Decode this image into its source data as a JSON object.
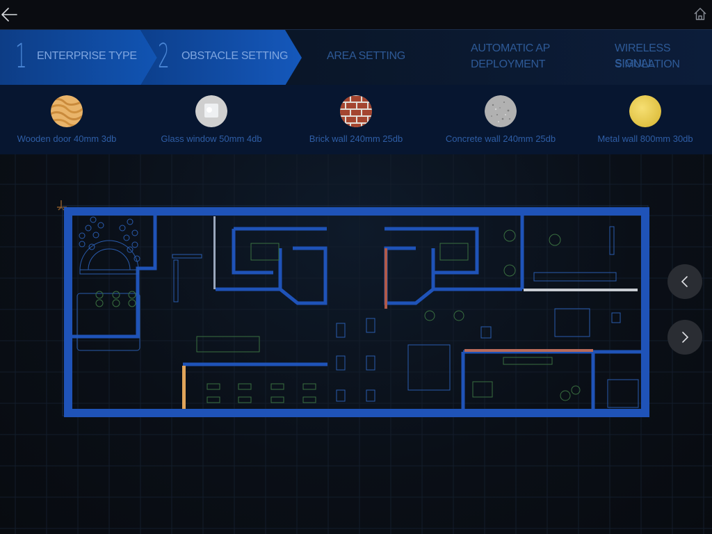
{
  "topbar": {
    "back_icon": "arrow-left-icon",
    "home_icon": "home-icon"
  },
  "steps": [
    {
      "number": "1",
      "label": "ENTERPRISE TYPE",
      "state": "completed"
    },
    {
      "number": "2",
      "label": "OBSTACLE SETTING",
      "state": "active"
    },
    {
      "number": "",
      "label": "AREA SETTING",
      "state": "inactive"
    },
    {
      "number": "",
      "label_line1": "AUTOMATIC AP",
      "label_line2": "DEPLOYMENT",
      "state": "inactive"
    },
    {
      "number": "",
      "label_line1": "WIRELESS SIGNAL",
      "label_line2": "SIMULATION",
      "state": "inactive"
    }
  ],
  "materials": [
    {
      "name": "Wooden door 40mm 3db",
      "icon": "wood-texture-icon",
      "color": "#e3a85a"
    },
    {
      "name": "Glass window 50mm 4db",
      "icon": "glass-texture-icon",
      "color": "#c9c9c9"
    },
    {
      "name": "Brick wall 240mm 25db",
      "icon": "brick-texture-icon",
      "color": "#9a4430"
    },
    {
      "name": "Concrete wall 240mm 25db",
      "icon": "concrete-texture-icon",
      "color": "#a9a9a9"
    },
    {
      "name": "Metal wall 800mm 30db",
      "icon": "metal-texture-icon",
      "color": "#e8c94c"
    }
  ],
  "floorplan": {
    "wall_color": "#1f53b8",
    "furniture_blue": "#2a5cae",
    "furniture_green": "#3f7a3f",
    "wood_color": "#e0a45a",
    "brick_color": "#b05a4a",
    "glass_color": "#c8ccd2"
  },
  "nav": {
    "prev_icon": "chevron-left-icon",
    "next_icon": "chevron-right-icon"
  }
}
